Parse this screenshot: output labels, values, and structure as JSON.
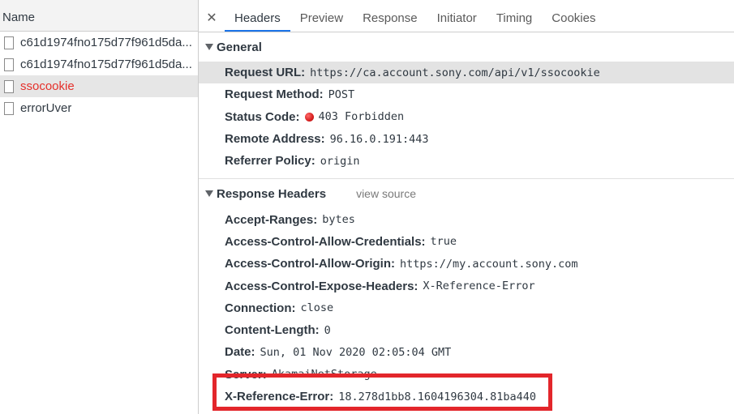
{
  "requests": {
    "header": "Name",
    "items": [
      {
        "label": "c61d1974fno175d77f961d5da..."
      },
      {
        "label": "c61d1974fno175d77f961d5da..."
      },
      {
        "label": "ssocookie"
      },
      {
        "label": "errorUver"
      }
    ]
  },
  "tabs": {
    "close": "✕",
    "items": [
      "Headers",
      "Preview",
      "Response",
      "Initiator",
      "Timing",
      "Cookies"
    ]
  },
  "general": {
    "title": "General",
    "rows": [
      {
        "key": "Request URL:",
        "value": "https://ca.account.sony.com/api/v1/ssocookie"
      },
      {
        "key": "Request Method:",
        "value": "POST"
      },
      {
        "key": "Status Code:",
        "value": "403 Forbidden"
      },
      {
        "key": "Remote Address:",
        "value": "96.16.0.191:443"
      },
      {
        "key": "Referrer Policy:",
        "value": "origin"
      }
    ]
  },
  "response_headers": {
    "title": "Response Headers",
    "view_source": "view source",
    "rows": [
      {
        "key": "Accept-Ranges:",
        "value": "bytes"
      },
      {
        "key": "Access-Control-Allow-Credentials:",
        "value": "true"
      },
      {
        "key": "Access-Control-Allow-Origin:",
        "value": "https://my.account.sony.com"
      },
      {
        "key": "Access-Control-Expose-Headers:",
        "value": "X-Reference-Error"
      },
      {
        "key": "Connection:",
        "value": "close"
      },
      {
        "key": "Content-Length:",
        "value": "0"
      },
      {
        "key": "Date:",
        "value": "Sun, 01 Nov 2020 02:05:04 GMT"
      },
      {
        "key": "Server:",
        "value": "AkamaiNetStorage"
      },
      {
        "key": "X-Reference-Error:",
        "value": "18.278d1bb8.1604196304.81ba440"
      }
    ]
  },
  "colors": {
    "accent": "#1a73e8",
    "error_text": "#e5302b",
    "status_error": "#d61f1f",
    "annotation_box": "#e3262b"
  },
  "icons": {
    "request_item": "document-icon",
    "status": "red-status-dot-icon",
    "section_toggle": "triangle-down-icon",
    "close": "close-icon"
  }
}
